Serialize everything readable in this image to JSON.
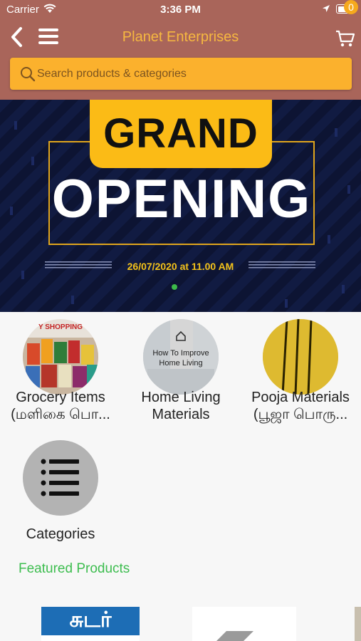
{
  "status_bar": {
    "carrier": "Carrier",
    "time": "3:36 PM"
  },
  "navbar": {
    "title": "Planet Enterprises",
    "cart_count": "0"
  },
  "search": {
    "placeholder": "Search products & categories"
  },
  "banner": {
    "headline_top": "GRAND",
    "headline_main": "OPENING",
    "date_text": "26/07/2020 at 11.00 AM",
    "active_slide": 1
  },
  "categories": [
    {
      "label_line1": "Grocery Items",
      "label_line2": "(மளிகை பொ...",
      "thumb_text": "Y SHOPPING"
    },
    {
      "label_line1": "Home Living",
      "label_line2": "Materials",
      "thumb_text_line1": "How To Improve",
      "thumb_text_line2": "Home Living"
    },
    {
      "label_line1": "Pooja Materials",
      "label_line2": "(பூஜா பொரு..."
    },
    {
      "label_line1": "Categories"
    }
  ],
  "featured": {
    "title": "Featured Products"
  },
  "products": [
    {
      "brand_text": "சுடர்"
    }
  ],
  "colors": {
    "header": "#a9655a",
    "accent": "#fbb12d",
    "title": "#f6b840",
    "featured": "#3dbd4f"
  }
}
